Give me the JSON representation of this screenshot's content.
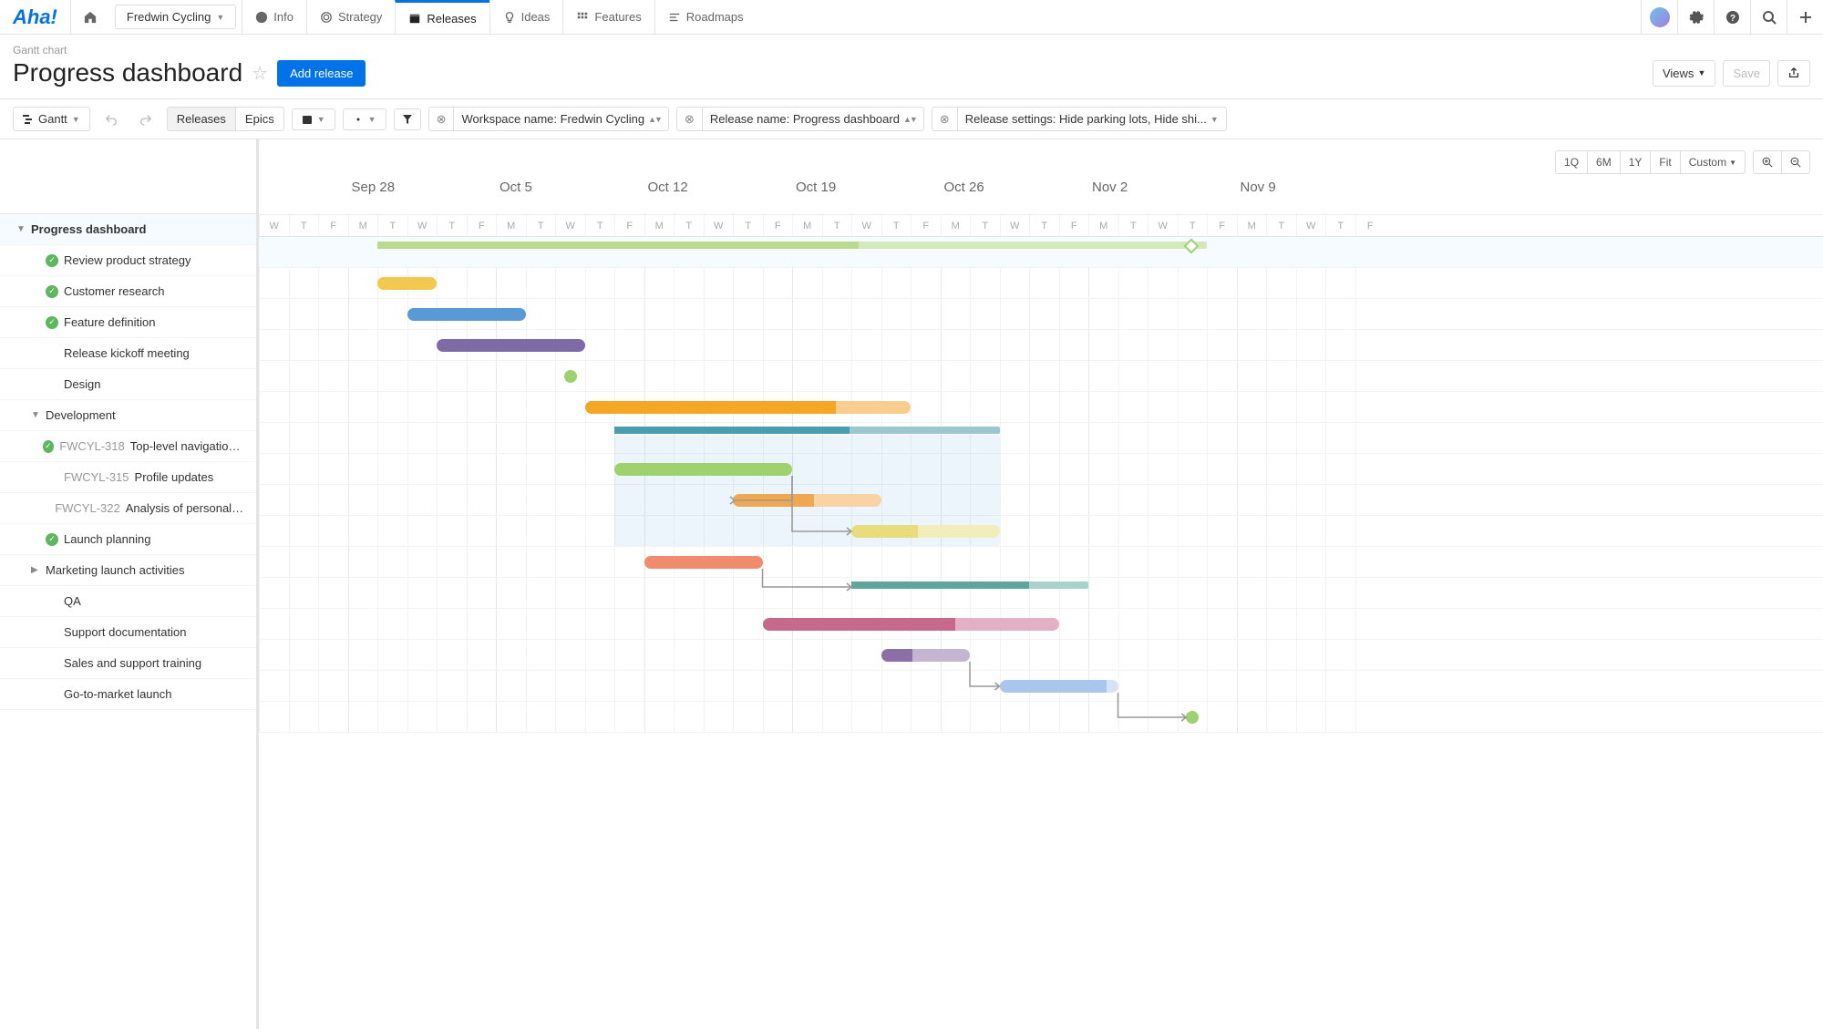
{
  "app": {
    "logo": "Aha!"
  },
  "nav": {
    "workspace": "Fredwin Cycling",
    "items": [
      {
        "label": "Info",
        "icon": "info-icon"
      },
      {
        "label": "Strategy",
        "icon": "target-icon"
      },
      {
        "label": "Releases",
        "icon": "calendar-icon",
        "active": true
      },
      {
        "label": "Ideas",
        "icon": "bulb-icon"
      },
      {
        "label": "Features",
        "icon": "grid-icon"
      },
      {
        "label": "Roadmaps",
        "icon": "roadmap-icon"
      }
    ]
  },
  "header": {
    "crumb": "Gantt chart",
    "title": "Progress dashboard",
    "add_btn": "Add release",
    "views_btn": "Views",
    "save_btn": "Save"
  },
  "toolbar": {
    "gantt_btn": "Gantt",
    "releases_btn": "Releases",
    "epics_btn": "Epics",
    "filters": [
      {
        "label": "Workspace name: Fredwin Cycling"
      },
      {
        "label": "Release name: Progress dashboard"
      },
      {
        "label": "Release settings: Hide parking lots, Hide shi..."
      }
    ]
  },
  "zoom": {
    "q": "1Q",
    "m6": "6M",
    "y1": "1Y",
    "fit": "Fit",
    "custom": "Custom"
  },
  "timeline": {
    "weeks": [
      "Sep 28",
      "Oct 5",
      "Oct 12",
      "Oct 19",
      "Oct 26",
      "Nov 2",
      "Nov 9"
    ],
    "days_pattern": [
      "W",
      "T",
      "F",
      "M",
      "T",
      "W",
      "T",
      "F"
    ],
    "lead_days": [
      "W",
      "T",
      "F"
    ]
  },
  "rows": [
    {
      "id": "r0",
      "label": "Progress dashboard",
      "indent": 0,
      "expand": "down",
      "parent": true
    },
    {
      "id": "r1",
      "label": "Review product strategy",
      "indent": 1,
      "done": true
    },
    {
      "id": "r2",
      "label": "Customer research",
      "indent": 1,
      "done": true
    },
    {
      "id": "r3",
      "label": "Feature definition",
      "indent": 1,
      "done": true
    },
    {
      "id": "r4",
      "label": "Release kickoff meeting",
      "indent": 1
    },
    {
      "id": "r5",
      "label": "Design",
      "indent": 1
    },
    {
      "id": "r6",
      "label": "Development",
      "indent": 1,
      "expand": "down"
    },
    {
      "id": "r7",
      "code": "FWCYL-318",
      "label": "Top-level navigation re...",
      "indent": 2,
      "done": true
    },
    {
      "id": "r8",
      "code": "FWCYL-315",
      "label": "Profile updates",
      "indent": 2
    },
    {
      "id": "r9",
      "code": "FWCYL-322",
      "label": "Analysis of personal race g...",
      "indent": 2
    },
    {
      "id": "r10",
      "label": "Launch planning",
      "indent": 1,
      "done": true
    },
    {
      "id": "r11",
      "label": "Marketing launch activities",
      "indent": 1,
      "expand": "right"
    },
    {
      "id": "r12",
      "label": "QA",
      "indent": 1
    },
    {
      "id": "r13",
      "label": "Support documentation",
      "indent": 1
    },
    {
      "id": "r14",
      "label": "Sales and support training",
      "indent": 1
    },
    {
      "id": "r15",
      "label": "Go-to-market launch",
      "indent": 1
    }
  ],
  "colors": {
    "yellow": "#f2c94c",
    "blue": "#5899d8",
    "purple": "#7e6aa6",
    "green": "#8bc34a",
    "orange": "#f5a623",
    "orange_l": "#f9cd8c",
    "teal": "#4a9eb0",
    "teal_l": "#9ac7d0",
    "lime": "#9ed26a",
    "lime_l": "#cde8b0",
    "orange2": "#f0a84e",
    "orange2_l": "#f8d3a3",
    "yellow2": "#e8dd7a",
    "yellow2_l": "#f3edb9",
    "salmon": "#f28b6b",
    "salmon_l": "#f8c0ad",
    "seagreen": "#5aa89b",
    "seagreen_l": "#a7d3cc",
    "rose": "#c7698b",
    "rose_l": "#e3b1c3",
    "violet": "#8a6fa9",
    "violet_l": "#c4b5d3",
    "sky": "#a9c7ec",
    "sky_l": "#d4e3f5"
  }
}
